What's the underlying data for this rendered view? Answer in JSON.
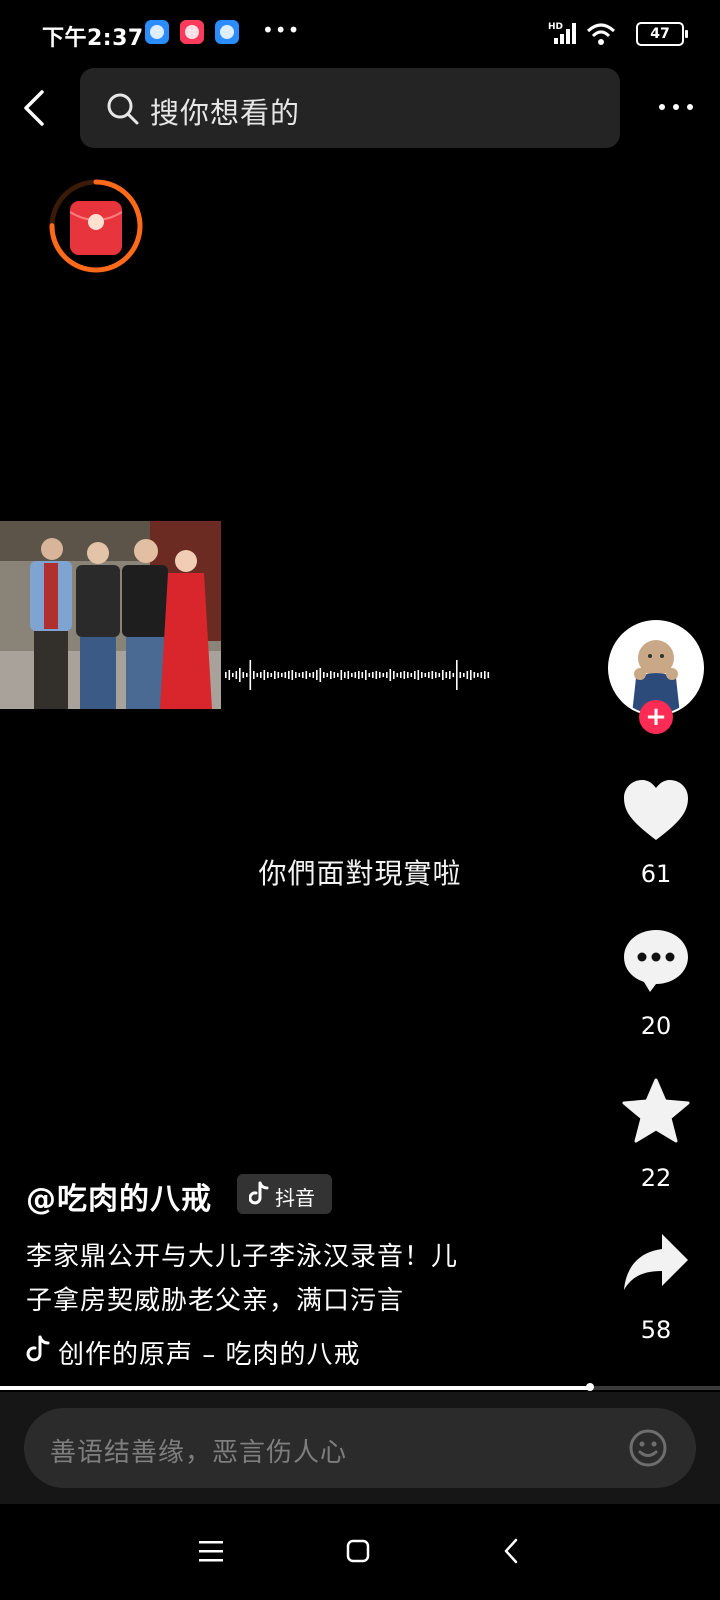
{
  "status_bar": {
    "time": "下午2:37",
    "more": "•••",
    "battery": "47",
    "network": "HD",
    "icons": [
      "messenger-icon",
      "douyin-icon",
      "messenger-icon",
      "signal-icon",
      "wifi-icon",
      "battery-icon"
    ]
  },
  "header": {
    "search_placeholder": "搜你想看的",
    "icons": [
      "back-arrow-icon",
      "search-icon",
      "more-icon"
    ]
  },
  "red_packet": {
    "icon": "red-packet-icon",
    "ring_color": "#ff6a1a",
    "progress": 0.75
  },
  "video": {
    "subtitle": "你們面對現實啦",
    "progress": 0.82
  },
  "actions": {
    "likes": "61",
    "comments": "20",
    "favorites": "22",
    "shares": "58"
  },
  "post": {
    "author": "@吃肉的八戒",
    "platform_badge": "抖音",
    "description_line1": "李家鼎公开与大儿子李泳汉录音！儿",
    "description_line2": "子拿房契威胁老父亲，满口污言",
    "music": "创作的原声 – 吃肉的八戒"
  },
  "comment_bar": {
    "placeholder": "善语结善缘，恶言伤人心"
  },
  "colors": {
    "background": "#000000",
    "accent_red": "#fe2c55",
    "packet_red": "#e8343c",
    "search_bg": "#242424"
  }
}
